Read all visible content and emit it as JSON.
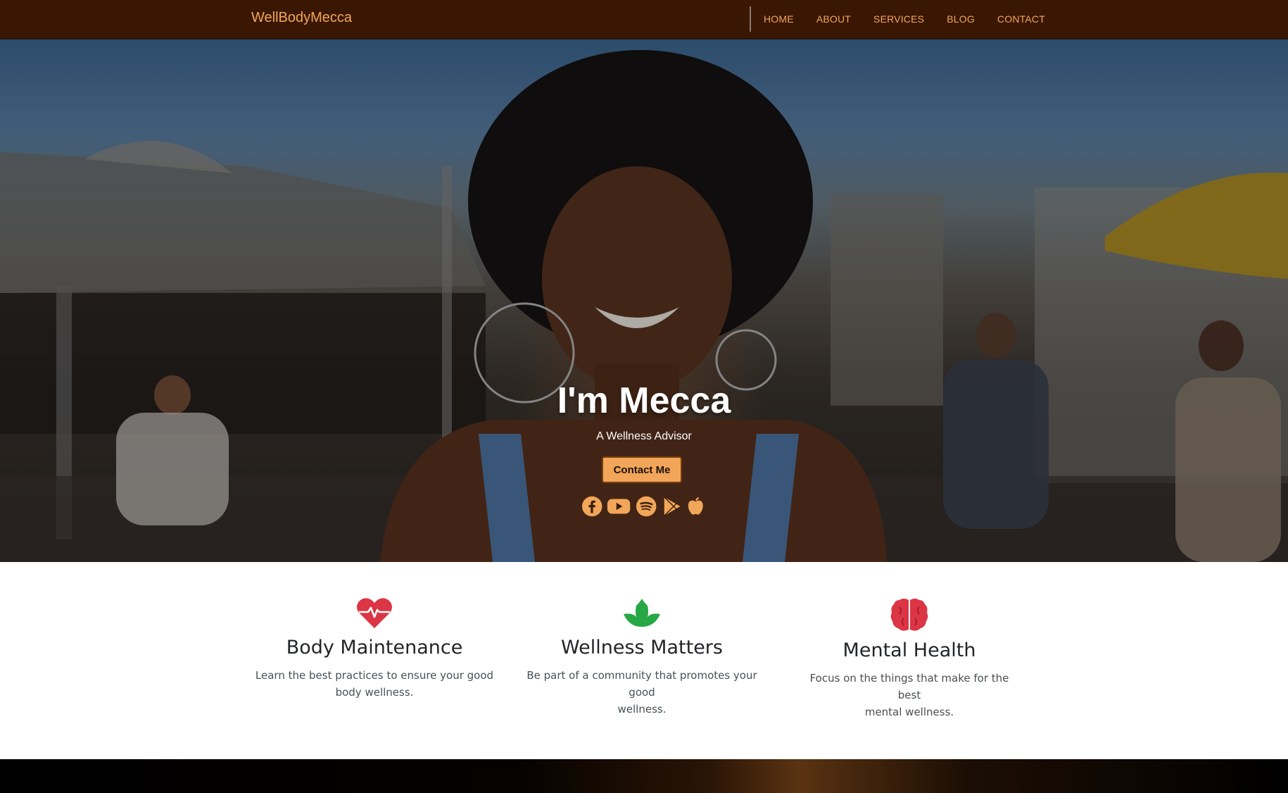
{
  "navbar": {
    "brand": "WellBodyMecca",
    "links": [
      "HOME",
      "ABOUT",
      "SERVICES",
      "BLOG",
      "CONTACT"
    ]
  },
  "hero": {
    "title": "I'm Mecca",
    "subtitle": "A Wellness Advisor",
    "cta_label": "Contact Me",
    "social_icons": [
      "facebook-icon",
      "youtube-icon",
      "spotify-icon",
      "google-play-icon",
      "apple-icon"
    ]
  },
  "features": [
    {
      "icon": "heart-pulse-icon",
      "title": "Body Maintenance",
      "description_line1": "Learn the best practices to ensure your good",
      "description_line2": "body wellness."
    },
    {
      "icon": "leaf-icon",
      "title": "Wellness Matters",
      "description_line1": "Be part of a community that promotes your good",
      "description_line2": "wellness."
    },
    {
      "icon": "brain-icon",
      "title": "Mental Health",
      "description_line1": "Focus on the things that make for the best",
      "description_line2": "mental wellness."
    }
  ],
  "colors": {
    "navbar_bg": "#3a1702",
    "accent": "#f2a65a",
    "heart_red": "#dc3545",
    "leaf_green": "#28a745",
    "brain_red": "#dc3545"
  }
}
